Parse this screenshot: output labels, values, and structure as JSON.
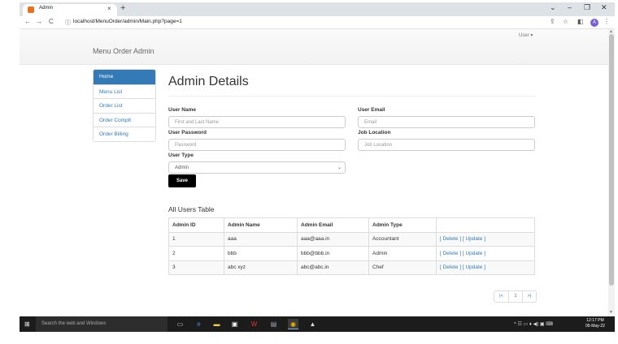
{
  "browser": {
    "tab_title": "Admin",
    "tab_close": "×",
    "new_tab": "+",
    "url": "localhost/MenuOrder/admin/Main.php?page=1",
    "profile_initial": "A",
    "controls": {
      "chevron": "⌄",
      "minimize": "–",
      "restore": "❐",
      "close": "✕"
    },
    "nav": {
      "back": "←",
      "forward": "→",
      "reload": "C",
      "info": "ⓘ"
    }
  },
  "page": {
    "user_menu": "User ▾",
    "brand": "Menu Order Admin",
    "sidebar": {
      "items": [
        {
          "label": "Home",
          "active": true
        },
        {
          "label": "Menu List"
        },
        {
          "label": "Order List"
        },
        {
          "label": "Order Complt"
        },
        {
          "label": "Order Billing"
        }
      ]
    },
    "heading": "Admin Details",
    "form": {
      "user_name": {
        "label": "User Name",
        "placeholder": "First and Last Name"
      },
      "user_email": {
        "label": "User Email",
        "placeholder": "Email"
      },
      "user_password": {
        "label": "User Password",
        "placeholder": "Password"
      },
      "job_location": {
        "label": "Job Location",
        "placeholder": "Job Location"
      },
      "user_type": {
        "label": "User Type",
        "value": "Admin"
      },
      "save_label": "Save"
    },
    "table": {
      "title": "All Users Table",
      "headers": [
        "Admin ID",
        "Admin Name",
        "Admin Email",
        "Admin Type",
        ""
      ],
      "rows": [
        {
          "id": "1",
          "name": "aaa",
          "email": "aaa@aaa.in",
          "type": "Accountant",
          "delete": "[ Delete ]",
          "update": "[ Update ]"
        },
        {
          "id": "2",
          "name": "bbb",
          "email": "bbb@bbb.in",
          "type": "Admin",
          "delete": "[ Delete ]",
          "update": "[ Update ]"
        },
        {
          "id": "3",
          "name": "abc xyz",
          "email": "abc@abc.in",
          "type": "Chef",
          "delete": "[ Delete ]",
          "update": "[ Update ]"
        }
      ]
    },
    "pagination": {
      "first": "|<",
      "current": "1",
      "last": ">|"
    }
  },
  "taskbar": {
    "search_placeholder": "Search the web and Windows",
    "time": "12:17 PM",
    "date": "05-May-22"
  },
  "colors": {
    "accent": "#337ab7",
    "save_button": "#000000",
    "taskbar": "#1c1c1c"
  }
}
